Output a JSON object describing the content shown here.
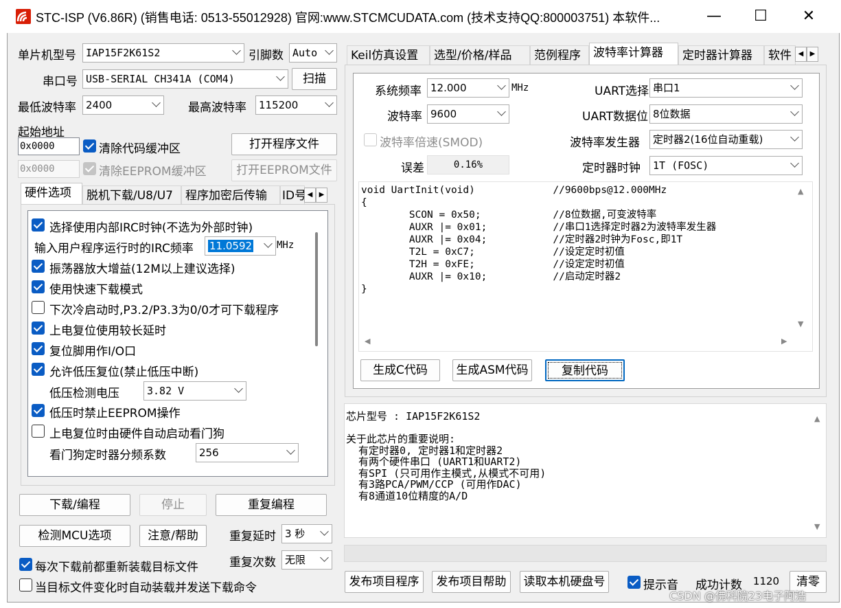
{
  "window": {
    "title": "STC-ISP (V6.86R) (销售电话: 0513-55012928) 官网:www.STCMCUDATA.com  (技术支持QQ:800003751) 本软件...",
    "minimize": "—",
    "maximize": "☐",
    "close": "✕"
  },
  "left": {
    "mcu_label": "单片机型号",
    "mcu_value": "IAP15F2K61S2",
    "pins_label": "引脚数",
    "pins_value": "Auto",
    "port_label": "串口号",
    "port_value": "USB-SERIAL CH341A (COM4)",
    "scan_button": "扫描",
    "min_baud_label": "最低波特率",
    "min_baud_value": "2400",
    "max_baud_label": "最高波特率",
    "max_baud_value": "115200",
    "start_addr_label": "起始地址",
    "addr1": "0x0000",
    "clear_code_label": "清除代码缓冲区",
    "open_program_button": "打开程序文件",
    "addr2": "0x0000",
    "clear_eeprom_label": "清除EEPROM缓冲区",
    "open_eeprom_button": "打开EEPROM文件",
    "tabs": [
      "硬件选项",
      "脱机下载/U8/U7",
      "程序加密后传输",
      "ID号"
    ],
    "options": {
      "opt1": "选择使用内部IRC时钟(不选为外部时钟)",
      "irc_label": "输入用户程序运行时的IRC频率",
      "irc_value": "11.0592",
      "irc_unit": "MHz",
      "opt2": "振荡器放大增益(12M以上建议选择)",
      "opt3": "使用快速下载模式",
      "opt4": "下次冷启动时,P3.2/P3.3为0/0才可下载程序",
      "opt5": "上电复位使用较长延时",
      "opt6": "复位脚用作I/O口",
      "opt7": "允许低压复位(禁止低压中断)",
      "lv_label": "低压检测电压",
      "lv_value": "3.82 V",
      "opt8": "低压时禁止EEPROM操作",
      "opt9": "上电复位时由硬件自动启动看门狗",
      "wdt_label": "看门狗定时器分频系数",
      "wdt_value": "256"
    },
    "download_button": "下载/编程",
    "stop_button": "停止",
    "reprogram_button": "重复编程",
    "detect_button": "检测MCU选项",
    "help_button": "注意/帮助",
    "repeat_delay_label": "重复延时",
    "repeat_delay_value": "3 秒",
    "repeat_count_label": "重复次数",
    "repeat_count_value": "无限",
    "reload_label": "每次下载前都重新装载目标文件",
    "auto_send_label": "当目标文件变化时自动装载并发送下载命令"
  },
  "right": {
    "tabs": [
      "Keil仿真设置",
      "选型/价格/样品",
      "范例程序",
      "波特率计算器",
      "定时器计算器",
      "软件"
    ],
    "sysfreq_label": "系统频率",
    "sysfreq_value": "12.000",
    "sysfreq_unit": "MHz",
    "uart_label": "UART选择",
    "uart_value": "串口1",
    "baud_label": "波特率",
    "baud_value": "9600",
    "databits_label": "UART数据位",
    "databits_value": "8位数据",
    "smod_label": "波特率倍速(SMOD)",
    "gen_label": "波特率发生器",
    "gen_value": "定时器2(16位自动重载)",
    "error_label": "误差",
    "error_value": "0.16%",
    "clock_label": "定时器时钟",
    "clock_value": "1T  (FOSC)",
    "code": "void UartInit(void)\t\t//9600bps@12.000MHz\n{\n\tSCON = 0x50;\t\t//8位数据,可变波特率\n\tAUXR |= 0x01;\t\t//串口1选择定时器2为波特率发生器\n\tAUXR |= 0x04;\t\t//定时器2时钟为Fosc,即1T\n\tT2L = 0xC7;\t\t//设定定时初值\n\tT2H = 0xFE;\t\t//设定定时初值\n\tAUXR |= 0x10;\t\t//启动定时器2\n}",
    "gen_c_button": "生成C代码",
    "gen_asm_button": "生成ASM代码",
    "copy_button": "复制代码",
    "info": "芯片型号 : IAP15F2K61S2\n\n关于此芯片的重要说明:\n  有定时器0, 定时器1和定时器2\n  有两个硬件串口 (UART1和UART2)\n  有SPI (只可用作主模式,从模式不可用)\n  有3路PCA/PWM/CCP (可用作DAC)\n  有8通道10位精度的A/D",
    "publish_button": "发布项目程序",
    "publish_help_button": "发布项目帮助",
    "read_disk_button": "读取本机硬盘号",
    "hint_label": "提示音",
    "success_label": "成功计数",
    "success_value": "1120",
    "clear_button": "清零"
  },
  "watermark": "CSDN @佛科院23电子阿浩"
}
